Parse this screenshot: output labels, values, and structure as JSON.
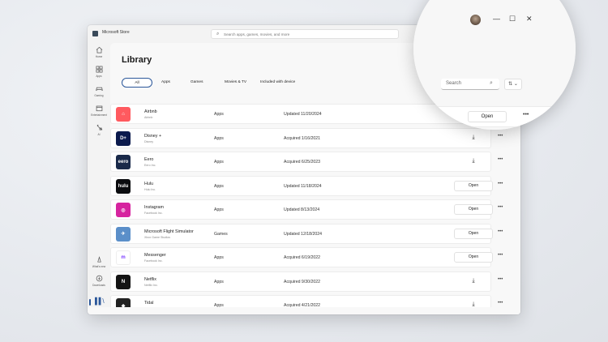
{
  "window": {
    "app_title": "Microsoft Store",
    "search_placeholder": "Search apps, games, movies, and more"
  },
  "sidebar": {
    "items": [
      {
        "label": "Home",
        "icon": "home-icon"
      },
      {
        "label": "Apps",
        "icon": "apps-icon"
      },
      {
        "label": "Gaming",
        "icon": "gaming-icon"
      },
      {
        "label": "Entertainment",
        "icon": "entertainment-icon"
      },
      {
        "label": "AI",
        "icon": "ai-icon"
      }
    ],
    "bottom_items": [
      {
        "label": "What's new",
        "icon": "whats-new-icon"
      },
      {
        "label": "Downloads",
        "icon": "downloads-icon"
      }
    ],
    "library_icon": "library-icon"
  },
  "page": {
    "title": "Library",
    "filters": [
      "All",
      "Apps",
      "Games",
      "Movies & TV",
      "Included with device"
    ],
    "active_filter": "All",
    "search_placeholder": "Search"
  },
  "rows": [
    {
      "name": "Airbnb",
      "publisher": "Airbnb",
      "type": "Apps",
      "status": "Updated 11/20/2024",
      "action": "Open",
      "logo_color": "#ff5a5f",
      "logo_text": "⌂"
    },
    {
      "name": "Disney +",
      "publisher": "Disney",
      "type": "Apps",
      "status": "Acquired 1/16/2021",
      "action": "download",
      "logo_color": "#0b1a4d",
      "logo_text": "D+"
    },
    {
      "name": "Eero",
      "publisher": "Eero Inc.",
      "type": "Apps",
      "status": "Acquired 6/25/2023",
      "action": "download",
      "logo_color": "#1a2a4a",
      "logo_text": "eero"
    },
    {
      "name": "Hulu",
      "publisher": "Hulu Inc.",
      "type": "Apps",
      "status": "Updated 11/18/2024",
      "action": "Open",
      "logo_color": "#0b0c0f",
      "logo_text": "hulu"
    },
    {
      "name": "Instagram",
      "publisher": "Facebook Inc.",
      "type": "Apps",
      "status": "Updated 8/13/2024",
      "action": "Open",
      "logo_color": "#d6249f",
      "logo_text": "◎"
    },
    {
      "name": "Microsoft Flight Simulator",
      "publisher": "Xbox Game Studios",
      "type": "Games",
      "status": "Updated 12/18/2024",
      "action": "Open",
      "logo_color": "#5b8fc9",
      "logo_text": "✈"
    },
    {
      "name": "Messenger",
      "publisher": "Facebook Inc.",
      "type": "Apps",
      "status": "Acquired 6/19/2022",
      "action": "Open",
      "logo_color": "#ffffff",
      "logo_text": "m"
    },
    {
      "name": "Netflix",
      "publisher": "Netflix Inc.",
      "type": "Apps",
      "status": "Acquired 9/30/2022",
      "action": "download",
      "logo_color": "#141414",
      "logo_text": "N"
    },
    {
      "name": "Tidal",
      "publisher": "",
      "type": "Apps",
      "status": "Acquired 4/21/2022",
      "action": "download",
      "logo_color": "#222222",
      "logo_text": "◆"
    }
  ],
  "magnifier": {
    "avatar": "user-avatar",
    "search_placeholder": "Search",
    "open_label": "Open"
  }
}
